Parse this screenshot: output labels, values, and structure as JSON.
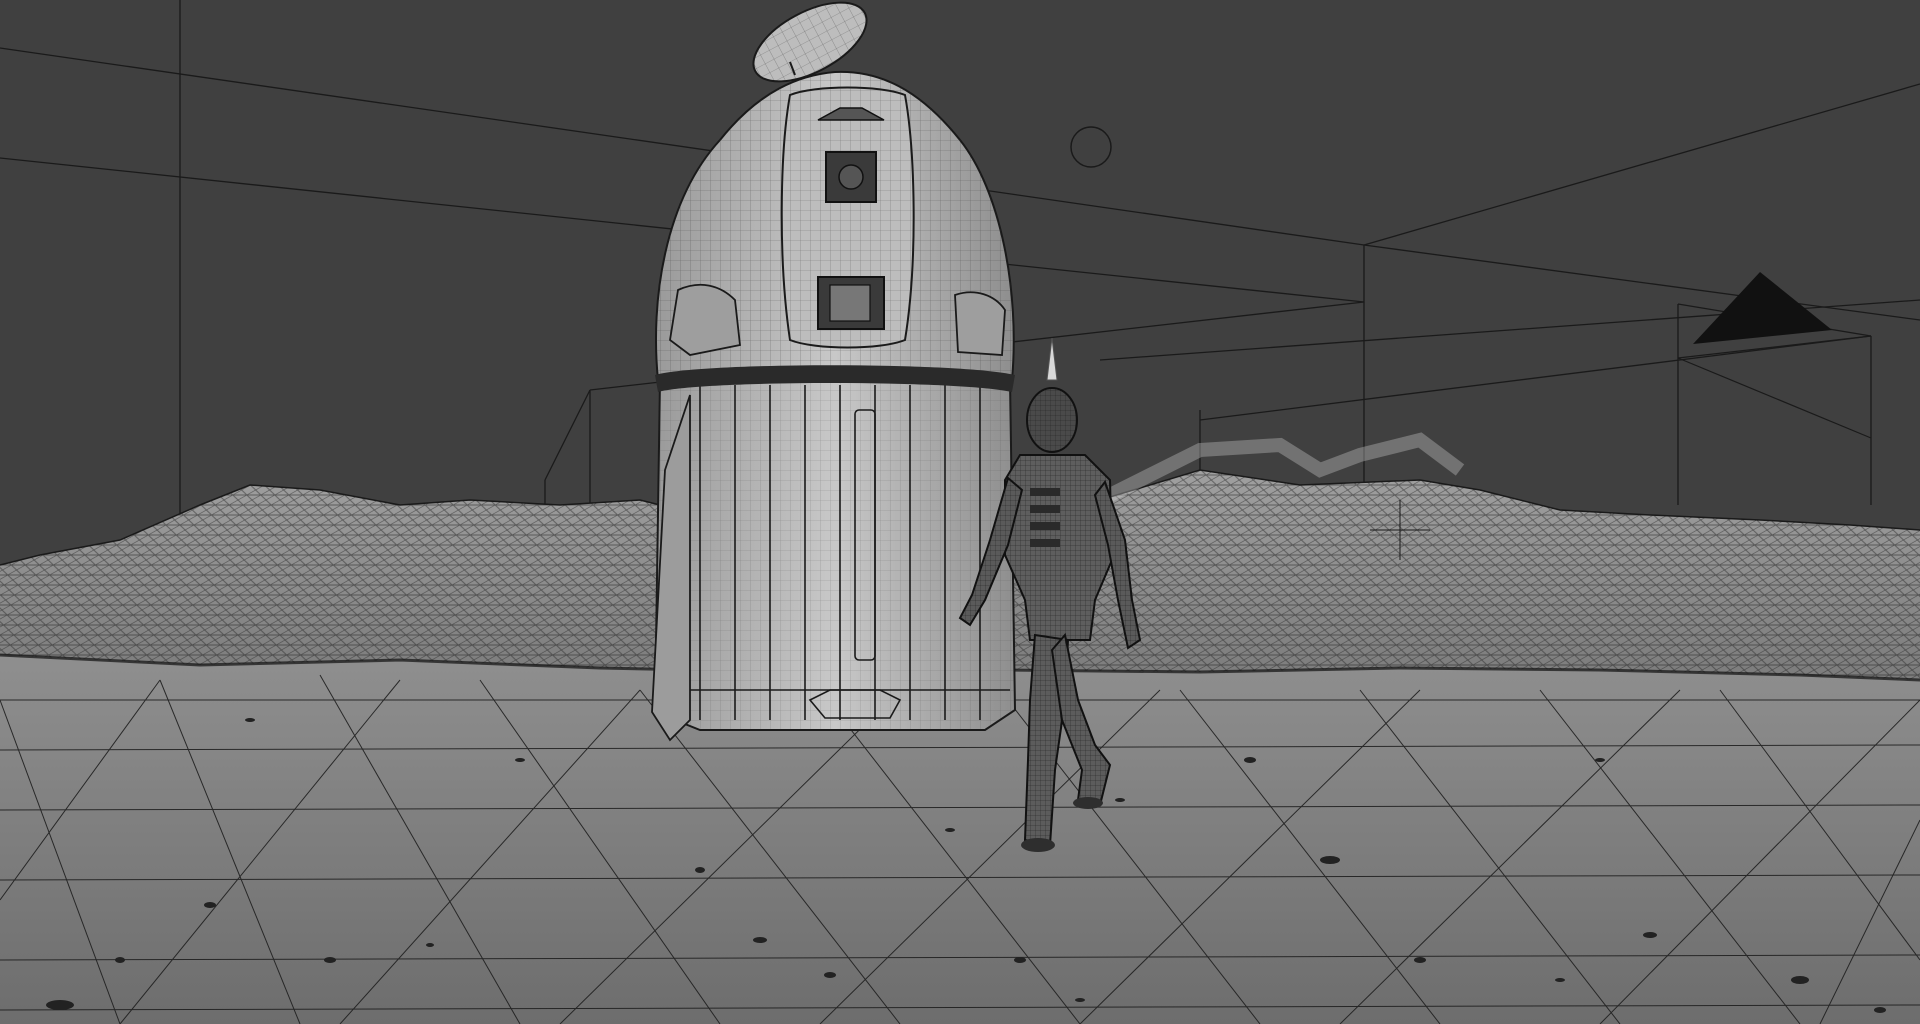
{
  "viewport": {
    "mode": "wireframe",
    "background_color": "#404040",
    "ground_fill_color": "#7a7a7a",
    "hill_fill_color": "#8e8e8e",
    "wire_color": "#1a1a1a",
    "capsule_fill_color": "#b5b5b5",
    "astronaut_fill_color": "#5a5a5a"
  },
  "scene_objects": {
    "capsule": "space-capsule",
    "antenna_dish": "antenna-dish",
    "astronaut": "astronaut-figure",
    "terrain": "lunar-terrain",
    "hills": "background-hills",
    "camera": "camera-gizmo",
    "light": "light-gizmo",
    "empty": "empty-object"
  }
}
